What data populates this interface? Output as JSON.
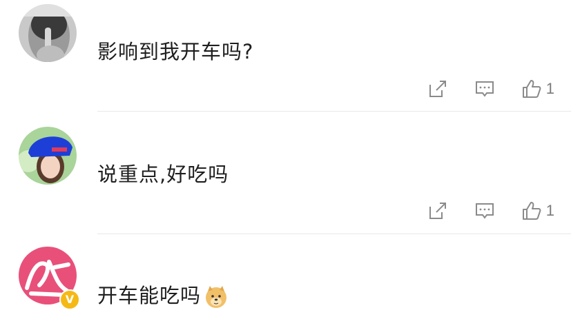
{
  "comments": [
    {
      "text": "影响到我开车吗?",
      "like_count": "1",
      "avatar_icon": "shush-gesture-avatar"
    },
    {
      "text": "说重点,好吃吗",
      "like_count": "1",
      "avatar_icon": "girl-blue-hat-avatar"
    },
    {
      "text": "开车能吃吗",
      "avatar_icon": "calligraphy-logo-avatar",
      "emoji": "doge-emoji",
      "verified_badge": "V"
    }
  ],
  "colors": {
    "icon_gray": "#8a8a8a",
    "divider": "#e8e8e8",
    "badge": "#f5b916"
  }
}
